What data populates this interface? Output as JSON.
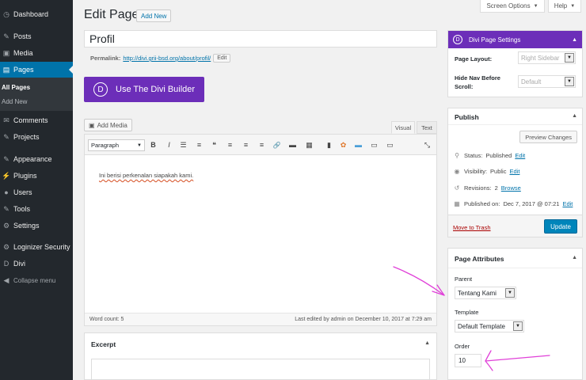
{
  "sidebar": {
    "items": [
      {
        "label": "Dashboard",
        "icon": "dashboard-icon",
        "glyph": "◷"
      },
      {
        "label": "Posts",
        "icon": "pin-icon",
        "glyph": "✎"
      },
      {
        "label": "Media",
        "icon": "media-icon",
        "glyph": "▣"
      },
      {
        "label": "Pages",
        "icon": "pages-icon",
        "glyph": "▤"
      },
      {
        "label": "Comments",
        "icon": "comments-icon",
        "glyph": "✉"
      },
      {
        "label": "Projects",
        "icon": "projects-icon",
        "glyph": "✎"
      },
      {
        "label": "Appearance",
        "icon": "appearance-icon",
        "glyph": "✎"
      },
      {
        "label": "Plugins",
        "icon": "plugins-icon",
        "glyph": "⚡"
      },
      {
        "label": "Users",
        "icon": "users-icon",
        "glyph": "●"
      },
      {
        "label": "Tools",
        "icon": "tools-icon",
        "glyph": "✎"
      },
      {
        "label": "Settings",
        "icon": "settings-icon",
        "glyph": "⚙"
      },
      {
        "label": "Loginizer Security",
        "icon": "loginizer-icon",
        "glyph": "⚙"
      },
      {
        "label": "Divi",
        "icon": "divi-icon",
        "glyph": "D"
      }
    ],
    "submenu": [
      "All Pages",
      "Add New"
    ],
    "collapse_label": "Collapse menu",
    "collapse_glyph": "◀",
    "active_color": "#0073aa"
  },
  "header": {
    "screen_options": "Screen Options",
    "help": "Help",
    "caret": "▼",
    "title": "Edit Page",
    "add_new": "Add New"
  },
  "post": {
    "title": "Profil",
    "permalink_label": "Permalink:",
    "permalink_url": "http://divi.grii-bsd.org/about/profil/",
    "permalink_edit": "Edit"
  },
  "divi_builder": {
    "icon": "D",
    "label": "Use The Divi Builder",
    "color": "#6c2eb9"
  },
  "editor": {
    "add_media": "Add Media",
    "tab_visual": "Visual",
    "tab_text": "Text",
    "format": "Paragraph",
    "toolbar_glyphs": [
      "B",
      "I",
      "☰",
      "≡",
      "❝",
      "≡",
      "≡",
      "≡",
      "🔗",
      "▬",
      "▦",
      "▮",
      "✿",
      "▬",
      "▭",
      "▭",
      "⤡"
    ],
    "content": "Ini berisi perkenalan siapakah kami.",
    "word_count": "Word count: 5",
    "last_edited": "Last edited by admin on December 10, 2017 at 7:29 am"
  },
  "excerpt": {
    "title": "Excerpt",
    "toggle": "▲"
  },
  "divi_settings": {
    "title": "Divi Page Settings",
    "icon": "D",
    "caret": "▲",
    "layout_label": "Page Layout:",
    "layout_value": "Right Sidebar",
    "hide_nav_label": "Hide Nav Before Scroll:",
    "hide_nav_value": "Default",
    "arrow": "▼"
  },
  "publish": {
    "title": "Publish",
    "toggle": "▲",
    "preview": "Preview Changes",
    "status_label": "Status:",
    "status_value": "Published",
    "status_edit": "Edit",
    "visibility_label": "Visibility:",
    "visibility_value": "Public",
    "visibility_edit": "Edit",
    "revisions_label": "Revisions:",
    "revisions_value": "2",
    "revisions_browse": "Browse",
    "published_label": "Published on:",
    "published_value": "Dec 7, 2017 @ 07:21",
    "published_edit": "Edit",
    "trash": "Move to Trash",
    "update": "Update",
    "icons": {
      "status": "⚲",
      "visibility": "◉",
      "revisions": "↺",
      "calendar": "▦"
    }
  },
  "attributes": {
    "title": "Page Attributes",
    "toggle": "▲",
    "parent_label": "Parent",
    "parent_value": "Tentang Kami",
    "template_label": "Template",
    "template_value": "Default Template",
    "order_label": "Order",
    "order_value": "10",
    "arrow": "▼"
  },
  "annotation_color": "#e040d8"
}
